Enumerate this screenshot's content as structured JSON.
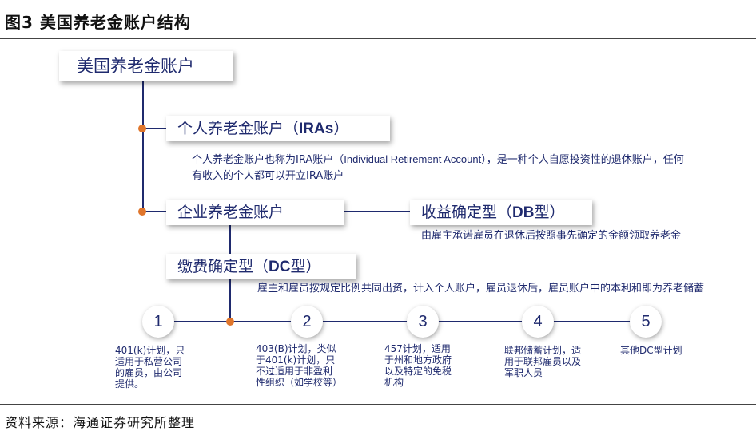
{
  "figure_title": "图3   美国养老金账户结构",
  "root": {
    "label": "美国养老金账户"
  },
  "ira": {
    "label_cn": "个人养老金账户（",
    "label_en": "IRAs",
    "label_end": "）",
    "desc_line1_a": "个人养老金账户也称为IRA账户（",
    "desc_line1_en": "Individual Retirement Account",
    "desc_line1_b": "），是一种个人自愿投资性的退休账户，任何",
    "desc_line2": "有收入的个人都可以开立IRA账户"
  },
  "corp": {
    "label": "企业养老金账户"
  },
  "db": {
    "label_cn": "收益确定型（",
    "label_en": "DB",
    "label_end": "型）",
    "desc": "由雇主承诺雇员在退休后按照事先确定的金额领取养老金"
  },
  "dc": {
    "label_cn": "缴费确定型（",
    "label_en": "DC",
    "label_end": "型）",
    "desc": "雇主和雇员按规定比例共同出资，计入个人账户，雇员退休后，雇员账户中的本利和即为养老储蓄"
  },
  "plans": [
    {
      "num": "1",
      "lines": [
        "401(k)计划，只",
        "适用于私营公司",
        "的雇员，由公司",
        "提供。"
      ]
    },
    {
      "num": "2",
      "lines": [
        "403(B)计划，类似",
        "于401(k)计划，只",
        "不过适用于非盈利",
        "性组织（如学校等）"
      ]
    },
    {
      "num": "3",
      "lines": [
        "457计划，适用",
        "于州和地方政府",
        "以及特定的免税",
        "机构"
      ]
    },
    {
      "num": "4",
      "lines": [
        "联邦储蓄计划，适",
        "用于联邦雇员以及",
        "军职人员"
      ]
    },
    {
      "num": "5",
      "lines": [
        "其他DC型计划"
      ]
    }
  ],
  "source": "资料来源：海通证券研究所整理",
  "colors": {
    "text": "#1f2a6e",
    "connector": "#1f2a6e",
    "dot": "#e0762c"
  }
}
